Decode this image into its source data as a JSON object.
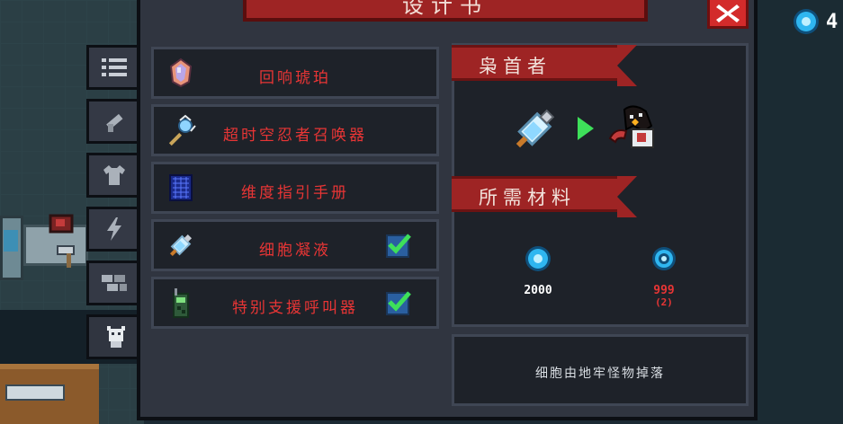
{
  "title": "设计书",
  "close_icon": "close-icon",
  "tabs": [
    {
      "icon": "list-icon",
      "active": false
    },
    {
      "icon": "weapon-icon",
      "active": false
    },
    {
      "icon": "shirt-icon",
      "active": false
    },
    {
      "icon": "lightning-icon",
      "active": false
    },
    {
      "icon": "blocks-icon",
      "active": false
    },
    {
      "icon": "character-icon",
      "active": true
    }
  ],
  "recipes": [
    {
      "label": "回响琥珀",
      "icon": "amber-gem-icon",
      "checked": false
    },
    {
      "label": "超时空忍者召唤器",
      "icon": "staff-icon",
      "checked": false
    },
    {
      "label": "维度指引手册",
      "icon": "manual-icon",
      "checked": false
    },
    {
      "label": "细胞凝液",
      "icon": "syringe-icon",
      "checked": true
    },
    {
      "label": "特别支援呼叫器",
      "icon": "radio-icon",
      "checked": true
    }
  ],
  "detail": {
    "target_name": "枭首者",
    "materials_title": "所需材料",
    "materials": [
      {
        "icon": "gem-icon",
        "amount": "2000",
        "note": ""
      },
      {
        "icon": "cell-icon",
        "amount": "999",
        "note": "(2)"
      }
    ],
    "description": "细胞由地牢怪物掉落"
  },
  "gem_counter": {
    "icon": "gem-icon",
    "value": "4"
  },
  "colors": {
    "accent_red": "#9e2424",
    "label_red": "#e83535",
    "gem_blue": "#2fb6f0",
    "check_green": "#3ee05a"
  }
}
